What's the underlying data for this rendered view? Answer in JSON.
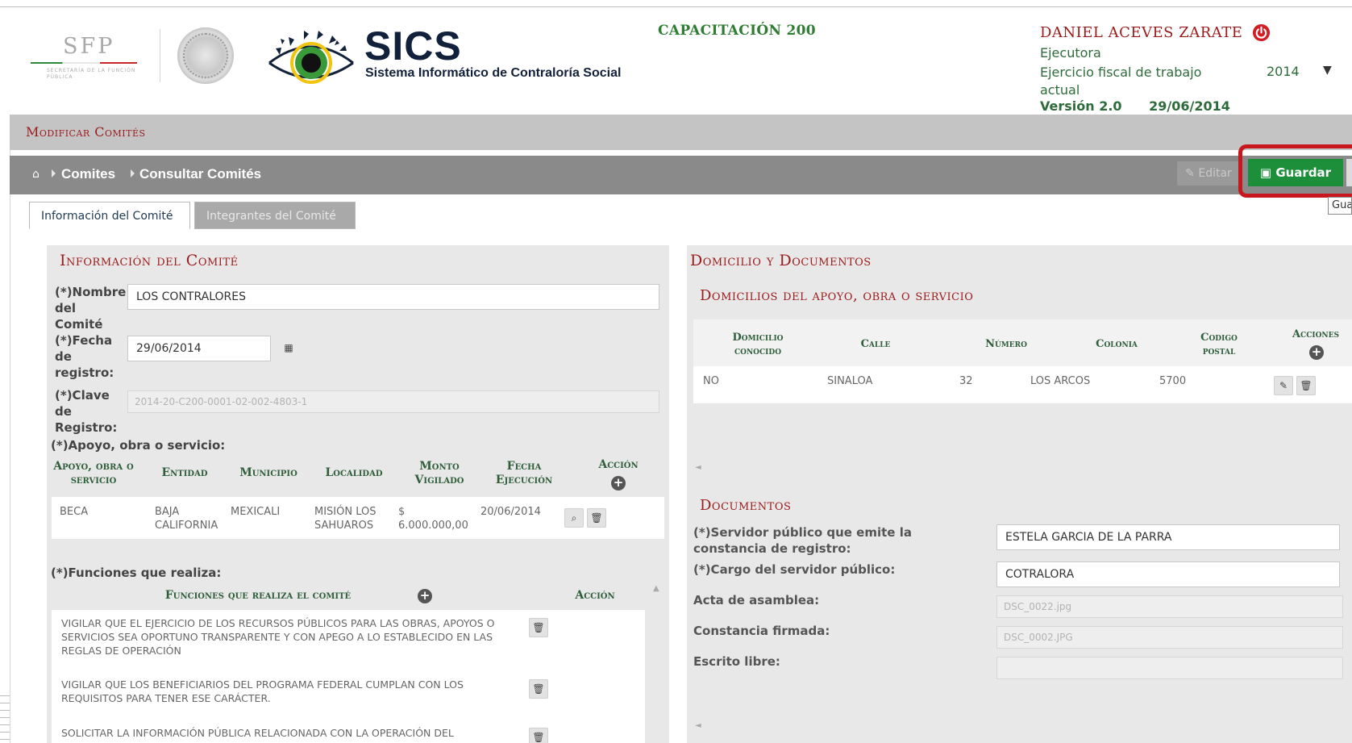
{
  "header": {
    "sfp_logo_text": "SFP",
    "sfp_logo_sub": "SECRETARÍA DE LA FUNCIÓN PÚBLICA",
    "app_title": "SICS",
    "app_subtitle": "Sistema Informático de Contraloría Social",
    "program": "CAPACITACIÓN 200",
    "user_name": "DANIEL ACEVES ZARATE",
    "user_role": "Ejecutora",
    "fiscal_label": "Ejercicio fiscal de trabajo actual",
    "fiscal_year": "2014",
    "version": "Versión 2.0",
    "version_date": "29/06/2014",
    "icons": {
      "power": "power-icon",
      "dropdown": "caret-down-icon"
    }
  },
  "page_title": "Modificar Comités",
  "breadcrumb": {
    "home_icon": "home-icon",
    "items": [
      "Comites",
      "Consultar Comités"
    ]
  },
  "toolbar": {
    "edit_label": "Editar",
    "save_label": "Guardar",
    "save_tooltip": "Gua",
    "highlight_color": "#c8181e",
    "save_color": "#1d8f3a"
  },
  "tabs": [
    {
      "label": "Información del Comité",
      "active": true
    },
    {
      "label": "Integrantes del Comité",
      "active": false
    }
  ],
  "info_comite": {
    "title": "Información del Comité",
    "nombre_label": "(*)Nombre del Comité",
    "nombre_value": "LOS CONTRALORES",
    "fecha_label": "(*)Fecha de registro:",
    "fecha_value": "29/06/2014",
    "clave_label": "(*)Clave de Registro:",
    "clave_value": "2014-20-C200-0001-02-002-4803-1",
    "apoyo_label": "(*)Apoyo, obra o servicio:",
    "apoyo_table": {
      "headers": [
        "Apoyo, obra o servicio",
        "Entidad",
        "Municipio",
        "Localidad",
        "Monto Vigilado",
        "Fecha Ejecución",
        "Acción"
      ],
      "rows": [
        [
          "BECA",
          "BAJA CALIFORNIA",
          "MEXICALI",
          "MISIÓN LOS SAHUAROS",
          "$ 6.000.000,00",
          "20/06/2014"
        ]
      ]
    },
    "funciones_label": "(*)Funciones que realiza:",
    "funciones_table": {
      "headers": [
        "Funciones que realiza el comité",
        "Acción"
      ],
      "rows": [
        "VIGILAR QUE EL EJERCICIO DE LOS RECURSOS PÚBLICOS PARA LAS OBRAS, APOYOS O SERVICIOS SEA OPORTUNO TRANSPARENTE Y CON APEGO A LO ESTABLECIDO EN LAS REGLAS DE OPERACIÓN",
        "VIGILAR QUE LOS BENEFICIARIOS DEL PROGRAMA FEDERAL CUMPLAN CON LOS REQUISITOS PARA TENER ESE CARÁCTER.",
        "SOLICITAR LA INFORMACIÓN PÚBLICA RELACIONADA CON LA OPERACIÓN DEL PROGRAMA"
      ]
    }
  },
  "domicilio": {
    "title": "Domicilio y Documentos",
    "subtitle": "Domicilios del apoyo, obra o servicio",
    "table": {
      "headers": [
        "Domicilio conocido",
        "Calle",
        "Número",
        "Colonia",
        "Codigo postal",
        "Acciones"
      ],
      "rows": [
        [
          "NO",
          "SINALOA",
          "32",
          "LOS ARCOS",
          "5700"
        ]
      ]
    }
  },
  "documentos": {
    "title": "Documentos",
    "servidor_label": "(*)Servidor público que emite la constancia de registro:",
    "servidor_value": "ESTELA GARCIA DE LA PARRA",
    "cargo_label": "(*)Cargo del servidor público:",
    "cargo_value": "COTRALORA",
    "acta_label": "Acta de asamblea:",
    "acta_value": "DSC_0022.jpg",
    "constancia_label": "Constancia firmada:",
    "constancia_value": "DSC_0002.JPG",
    "escrito_label": "Escrito libre:",
    "escrito_value": ""
  }
}
